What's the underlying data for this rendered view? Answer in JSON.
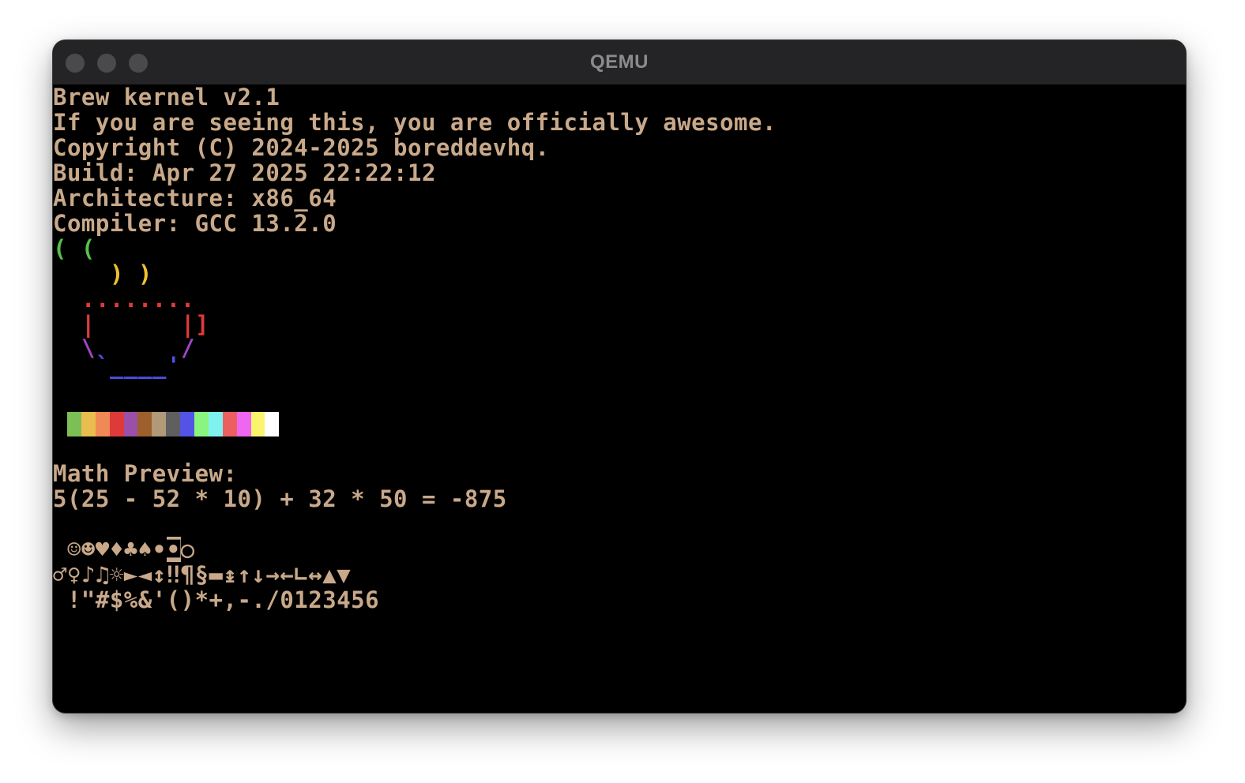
{
  "window": {
    "title": "QEMU"
  },
  "terminal": {
    "banner": [
      "Brew kernel v2.1",
      "If you are seeing this, you are officially awesome.",
      "Copyright (C) 2024-2025 boreddevhq.",
      "Build: Apr 27 2025 22:22:12",
      "Architecture: x86_64",
      "Compiler: GCC 13.2.0"
    ],
    "logo": {
      "steam_green": "( (",
      "steam_yellow": ") )",
      "rim": "........",
      "wall_left": "|",
      "wall_right": "|",
      "handle": "]",
      "side_left": "\\",
      "side_right": "/",
      "base_left": "`",
      "base": "____",
      "base_right": "'"
    },
    "palette_colors": [
      "#7dbf57",
      "#eabe4e",
      "#ef8a56",
      "#de3a3a",
      "#9b4fa8",
      "#9d5f2c",
      "#b09a78",
      "#5f5f5f",
      "#5353e6",
      "#8af57e",
      "#7ff2f0",
      "#ec5f5f",
      "#ef66f0",
      "#fbf56d",
      "#ffffff"
    ],
    "math": {
      "heading": "Math Preview:",
      "expression": "5(25 - 52 * 10) + 32 * 50 = -875"
    },
    "charset": {
      "row1_a": " ☺☻♥♦♣♠•",
      "row1_block": "◘",
      "row1_b": "○",
      "row2": "♂♀♪♫☼►◄↕‼¶§▬↨↑↓→←∟↔▲▼",
      "row3": " !\"#$%&'()*+,-./0123456"
    }
  },
  "colors": {
    "foreground": "#c9a98a",
    "background": "#000000",
    "titlebar": "#242426"
  }
}
